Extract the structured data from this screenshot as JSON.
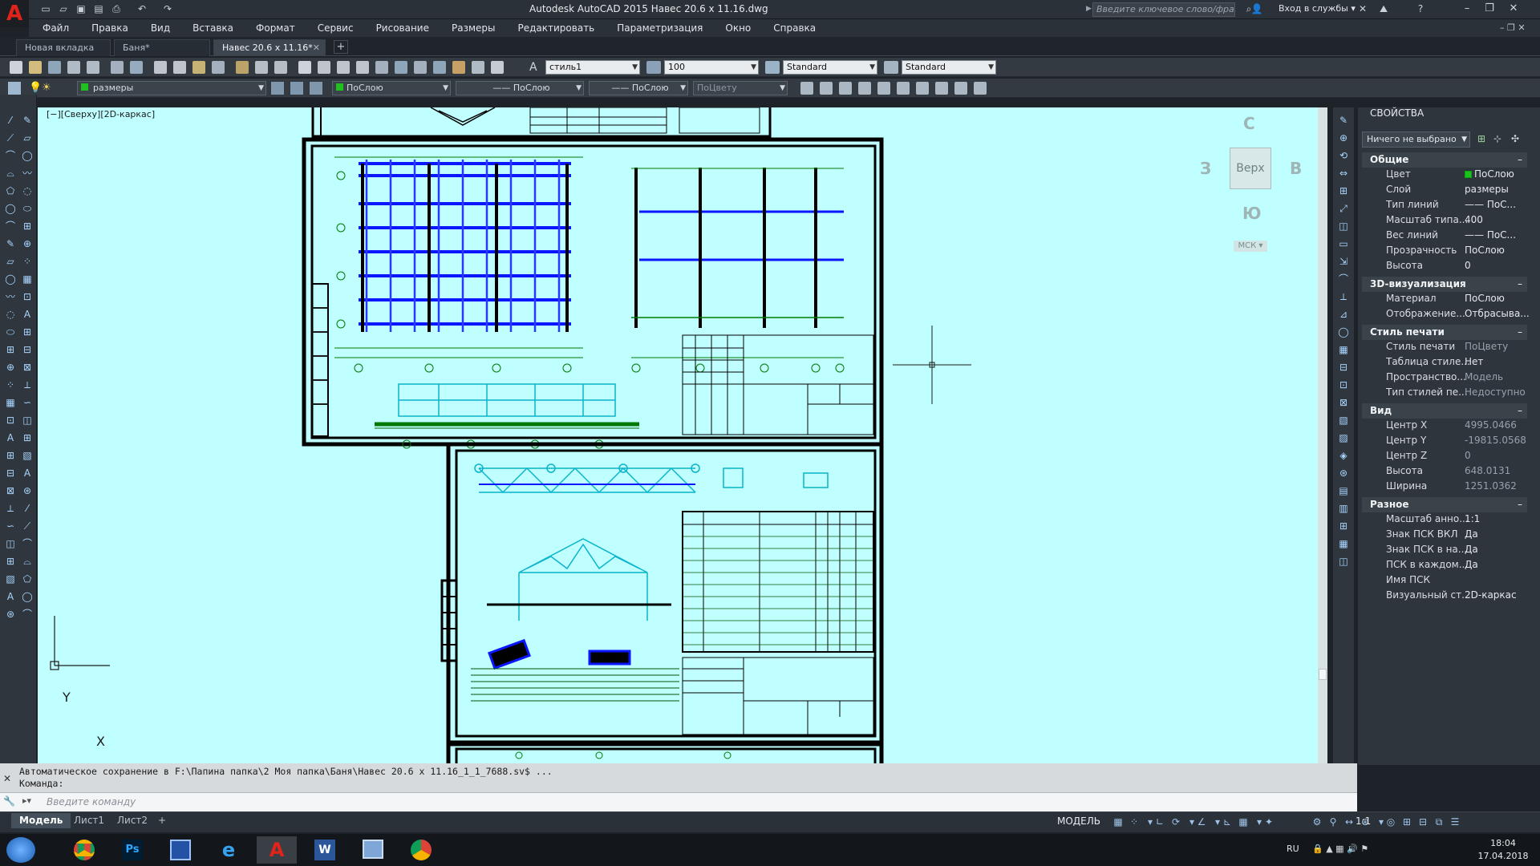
{
  "title_bar": {
    "app_title": "Autodesk AutoCAD 2015    Навес 20.6 x 11.16.dwg",
    "search_placeholder": "Введите ключевое слово/фразу",
    "signin_label": "Вход в службы"
  },
  "menu": [
    "Файл",
    "Правка",
    "Вид",
    "Вставка",
    "Формат",
    "Сервис",
    "Рисование",
    "Размеры",
    "Редактировать",
    "Параметризация",
    "Окно",
    "Справка"
  ],
  "doc_tabs": [
    {
      "label": "Новая вкладка",
      "active": false
    },
    {
      "label": "Баня*",
      "active": false
    },
    {
      "label": "Навес 20.6 x 11.16*",
      "active": true
    }
  ],
  "styles_toolbar": {
    "text_style": "стиль1",
    "dim_scale": "100",
    "dim_style": "Standard",
    "multileader_style": "Standard"
  },
  "layers_toolbar": {
    "current_layer": "размеры",
    "color": "ПоСлою",
    "linetype": "ПоСлою",
    "lineweight": "ПоСлою",
    "plot_style": "ПоЦвету"
  },
  "viewport": {
    "label": "[−][Сверху][2D-каркас]",
    "viewcube_top": "Верх",
    "viewcube_north": "С",
    "viewcube_south": "Ю",
    "viewcube_west": "З",
    "viewcube_east": "В",
    "wcs_label": "МСК",
    "ucs_x": "X",
    "ucs_y": "Y"
  },
  "properties": {
    "title": "СВОЙСТВА",
    "selection": "Ничего не выбрано",
    "sections": [
      {
        "name": "Общие",
        "rows": [
          {
            "k": "Цвет",
            "v": "ПоСлою"
          },
          {
            "k": "Слой",
            "v": "размеры"
          },
          {
            "k": "Тип линий",
            "v": "—— ПоС..."
          },
          {
            "k": "Масштаб типа...",
            "v": "400"
          },
          {
            "k": "Вес линий",
            "v": "—— ПоС..."
          },
          {
            "k": "Прозрачность",
            "v": "ПоСлою"
          },
          {
            "k": "Высота",
            "v": "0"
          }
        ]
      },
      {
        "name": "3D-визуализация",
        "rows": [
          {
            "k": "Материал",
            "v": "ПоСлою"
          },
          {
            "k": "Отображение...",
            "v": "Отбрасыва..."
          }
        ]
      },
      {
        "name": "Стиль печати",
        "rows": [
          {
            "k": "Стиль печати",
            "v": "ПоЦвету"
          },
          {
            "k": "Таблица стиле...",
            "v": "Нет"
          },
          {
            "k": "Пространство...",
            "v": "Модель"
          },
          {
            "k": "Тип стилей пе...",
            "v": "Недоступно"
          }
        ]
      },
      {
        "name": "Вид",
        "rows": [
          {
            "k": "Центр X",
            "v": "4995.0466"
          },
          {
            "k": "Центр Y",
            "v": "-19815.0568"
          },
          {
            "k": "Центр Z",
            "v": "0"
          },
          {
            "k": "Высота",
            "v": "648.0131"
          },
          {
            "k": "Ширина",
            "v": "1251.0362"
          }
        ]
      },
      {
        "name": "Разное",
        "rows": [
          {
            "k": "Масштаб анно...",
            "v": "1:1"
          },
          {
            "k": "Знак ПСК ВКЛ",
            "v": "Да"
          },
          {
            "k": "Знак ПСК в на...",
            "v": "Да"
          },
          {
            "k": "ПСК в каждом...",
            "v": "Да"
          },
          {
            "k": "Имя ПСК",
            "v": ""
          },
          {
            "k": "Визуальный ст...",
            "v": "2D-каркас"
          }
        ]
      }
    ]
  },
  "command": {
    "history_1": "Автоматическое сохранение в F:\\Папина папка\\2 Моя папка\\Баня\\Навес 20.6 x 11.16_1_1_7688.sv$ ...",
    "history_2": "Команда:",
    "input_placeholder": "Введите команду"
  },
  "layout_tabs": [
    {
      "label": "Модель",
      "active": true
    },
    {
      "label": "Лист1",
      "active": false
    },
    {
      "label": "Лист2",
      "active": false
    }
  ],
  "status": {
    "model_label": "МОДЕЛЬ",
    "annotation_scale": "1:1"
  },
  "taskbar": {
    "language": "RU",
    "time": "18:04",
    "date": "17.04.2018"
  }
}
